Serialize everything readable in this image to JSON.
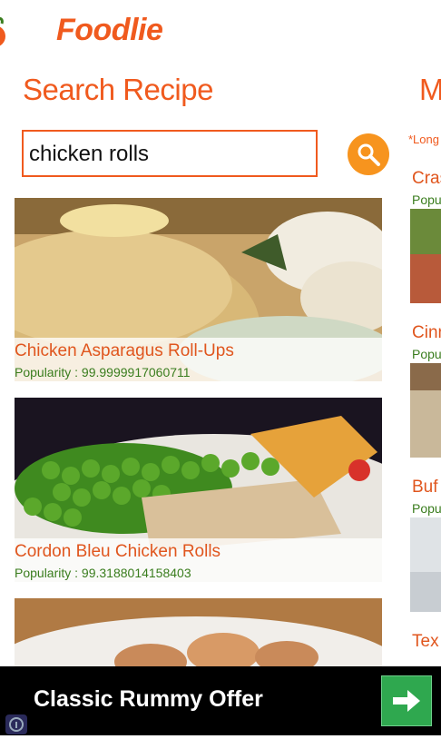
{
  "app": {
    "title": "Foodlie"
  },
  "search": {
    "section_title": "Search Recipe",
    "query": "chicken rolls"
  },
  "results": [
    {
      "title": "Chicken Asparagus Roll-Ups",
      "popularity": "Popularity : 99.9999917060711"
    },
    {
      "title": "Cordon Bleu Chicken Rolls",
      "popularity": "Popularity : 99.3188014158403"
    },
    {
      "title": "",
      "popularity": ""
    }
  ],
  "next_panel": {
    "title_fragment": "M",
    "note_fragment": "*Long",
    "items": [
      {
        "title": "Cras",
        "popularity": "Popul"
      },
      {
        "title": "Cinn",
        "popularity": "Popul"
      },
      {
        "title": "Buf",
        "popularity": "Popu"
      },
      {
        "title": "Tex",
        "popularity": ""
      }
    ]
  },
  "ad": {
    "text": "Classic Rummy Offer",
    "button_icon": "arrow-right-icon",
    "info_icon": "info-icon"
  },
  "colors": {
    "accent": "#f05a1e",
    "popularity_green": "#3a7d1e",
    "search_button": "#f7941e",
    "ad_button": "#2fa84f"
  }
}
